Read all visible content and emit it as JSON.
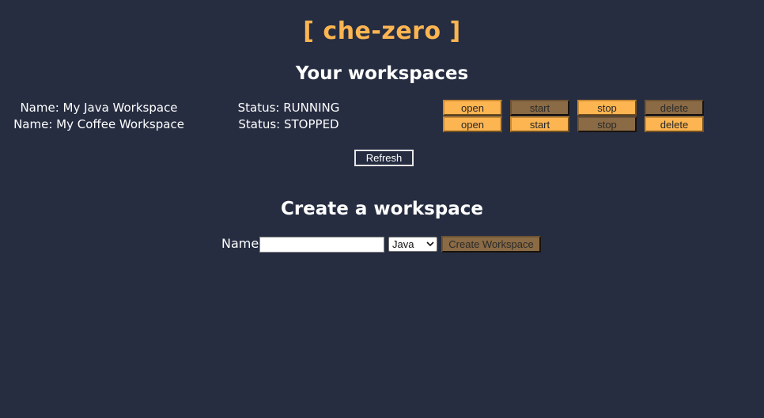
{
  "app": {
    "title": "[ che-zero ]",
    "accent_color": "#fdb551",
    "background_color": "#262d41",
    "disabled_button_color": "#8a6b45"
  },
  "workspaces_section": {
    "title": "Your workspaces",
    "refresh_label": "Refresh",
    "workspaces": [
      {
        "name": "Name: My Java Workspace",
        "status": "Status: RUNNING",
        "buttons": {
          "open": {
            "label": "open",
            "enabled": true
          },
          "start": {
            "label": "start",
            "enabled": false
          },
          "stop": {
            "label": "stop",
            "enabled": true
          },
          "delete": {
            "label": "delete",
            "enabled": false
          }
        }
      },
      {
        "name": "Name: My Coffee Workspace",
        "status": "Status: STOPPED",
        "buttons": {
          "open": {
            "label": "open",
            "enabled": true
          },
          "start": {
            "label": "start",
            "enabled": true
          },
          "stop": {
            "label": "stop",
            "enabled": false
          },
          "delete": {
            "label": "delete",
            "enabled": true
          }
        }
      }
    ]
  },
  "create_section": {
    "title": "Create a workspace",
    "name_label": "Name",
    "name_value": "",
    "name_placeholder": "",
    "language_selected": "Java",
    "create_label": "Create Workspace",
    "create_enabled": false
  }
}
